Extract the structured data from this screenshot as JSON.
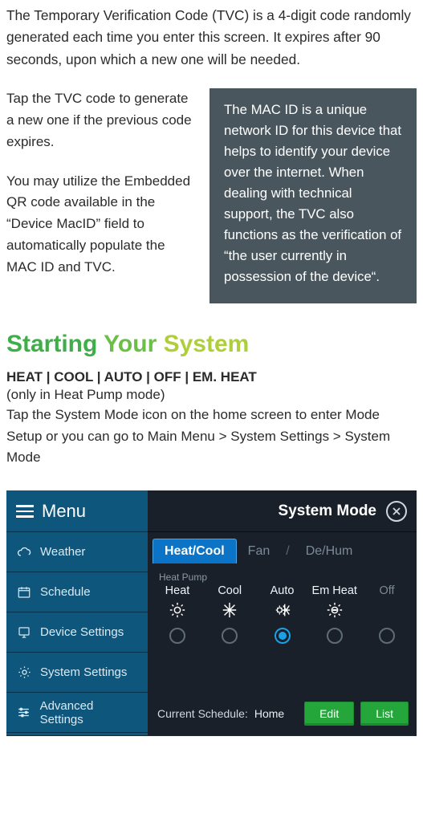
{
  "intro": "The Temporary Verification Code (TVC) is a 4-digit code randomly generated each time you enter this screen. It expires after 90 seconds, upon which a new one will be needed.",
  "left": {
    "p1": "Tap the TVC code to generate a new one if the previous code expires.",
    "p2": "You may utilize the Embedded QR code available in the “Device MacID” field to automatically populate the MAC ID and TVC."
  },
  "callout": "The MAC ID is a unique network ID for this device that helps to identify your device over the internet. When dealing with technical support, the TVC also functions as the verification of “the user currently in possession of the device“.",
  "section_heading": {
    "w1": "Starting",
    "w2": "Your",
    "w3": "System"
  },
  "modes_line": "HEAT | COOL | AUTO | OFF | EM. HEAT",
  "modes_sub": "(only in Heat Pump mode)",
  "modes_body": "Tap the System Mode icon on the home screen to enter Mode Setup or you can go to Main Menu > System Settings > System Mode",
  "device": {
    "menu_label": "Menu",
    "menu_items": [
      "Weather",
      "Schedule",
      "Device Settings",
      "System Settings",
      "Advanced Settings"
    ],
    "header_title": "System Mode",
    "tabs": {
      "active": "Heat/Cool",
      "fan": "Fan",
      "dehum": "De/Hum"
    },
    "hp_label": "Heat Pump",
    "modes": [
      {
        "label": "Heat"
      },
      {
        "label": "Cool"
      },
      {
        "label": "Auto"
      },
      {
        "label": "Em Heat"
      },
      {
        "label": "Off"
      }
    ],
    "selected_index": 2,
    "schedule_label": "Current Schedule:",
    "schedule_value": "Home",
    "edit_btn": "Edit",
    "list_btn": "List"
  }
}
